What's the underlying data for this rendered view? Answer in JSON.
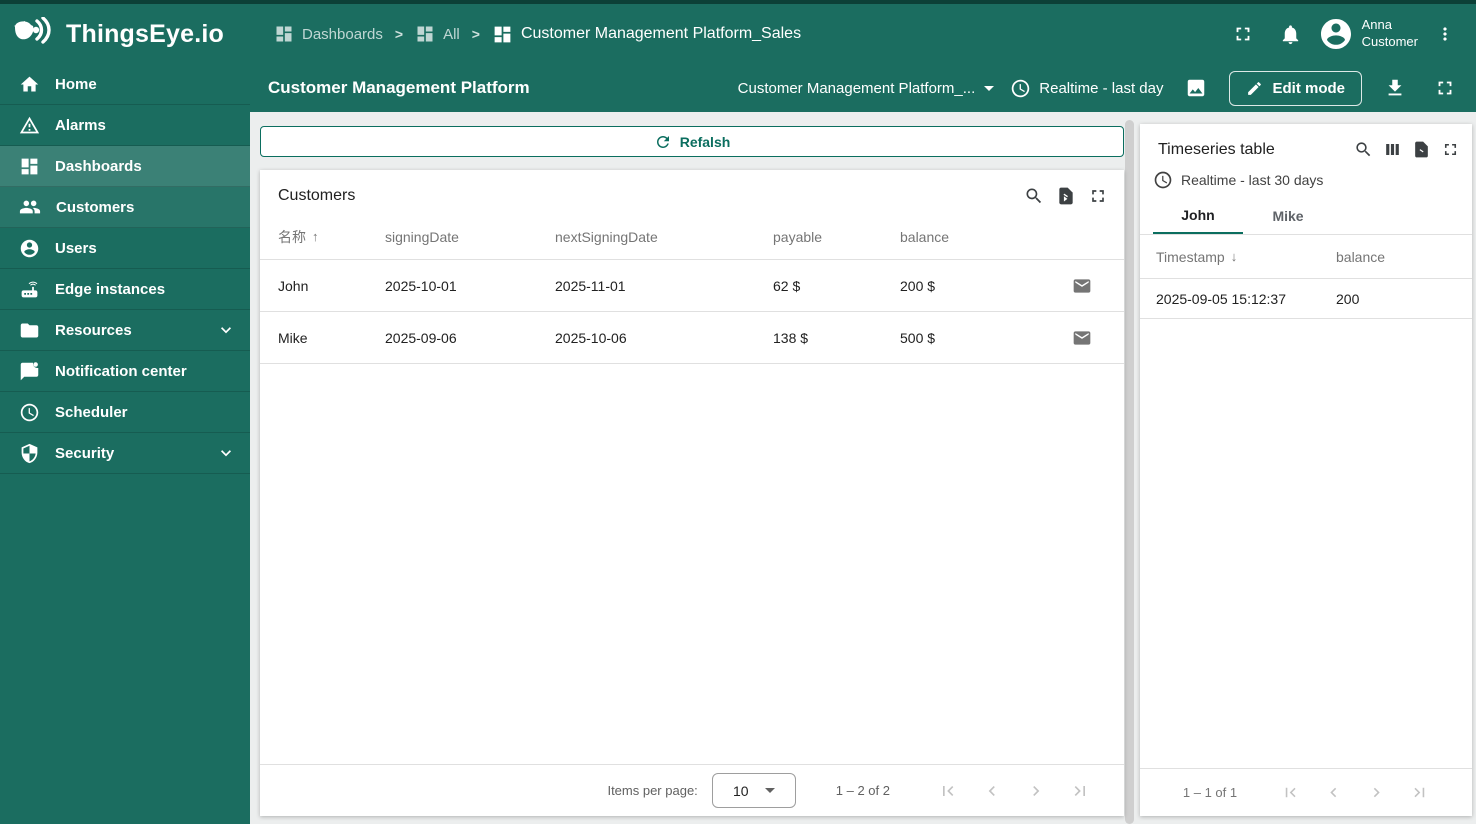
{
  "topbar": {
    "logo_text": "ThingsEye.io",
    "breadcrumbs": [
      {
        "label": "Dashboards"
      },
      {
        "label": "All"
      },
      {
        "label": "Customer Management Platform_Sales"
      }
    ],
    "user": {
      "name_line1": "Anna",
      "name_line2": "Customer"
    }
  },
  "toolbar": {
    "title": "Customer Management Platform",
    "state_select": "Customer Management Platform_...",
    "time_window": "Realtime - last day",
    "edit_mode_label": "Edit mode"
  },
  "sidebar": {
    "items": [
      {
        "label": "Home"
      },
      {
        "label": "Alarms"
      },
      {
        "label": "Dashboards"
      },
      {
        "label": "Customers"
      },
      {
        "label": "Users"
      },
      {
        "label": "Edge instances"
      },
      {
        "label": "Resources"
      },
      {
        "label": "Notification center"
      },
      {
        "label": "Scheduler"
      },
      {
        "label": "Security"
      }
    ]
  },
  "main": {
    "refresh_label": "Refalsh",
    "customers": {
      "title": "Customers",
      "columns": {
        "name": "名称",
        "signing": "signingDate",
        "next": "nextSigningDate",
        "payable": "payable",
        "balance": "balance"
      },
      "rows": [
        {
          "name": "John",
          "signing": "2025-10-01",
          "next": "2025-11-01",
          "payable": "62 $",
          "balance": "200 $"
        },
        {
          "name": "Mike",
          "signing": "2025-09-06",
          "next": "2025-10-06",
          "payable": "138 $",
          "balance": "500 $"
        }
      ],
      "paginator": {
        "items_per_page_label": "Items per page:",
        "page_size": "10",
        "range": "1 – 2 of 2"
      }
    }
  },
  "right_panel": {
    "title": "Timeseries table",
    "time_window": "Realtime - last 30 days",
    "tabs": [
      {
        "label": "John"
      },
      {
        "label": "Mike"
      }
    ],
    "columns": {
      "timestamp": "Timestamp",
      "balance": "balance"
    },
    "rows": [
      {
        "timestamp": "2025-09-05 15:12:37",
        "balance": "200"
      }
    ],
    "paginator": {
      "range": "1 – 1 of 1"
    }
  },
  "icons": {
    "breadcrumb_sep": ">",
    "sort_asc": "↑",
    "sort_desc": "↓"
  },
  "colors": {
    "teal": "#1b6d60",
    "teal_dark": "#0c4037",
    "accent": "#0b6e5f",
    "content_bg": "#eceeee"
  }
}
